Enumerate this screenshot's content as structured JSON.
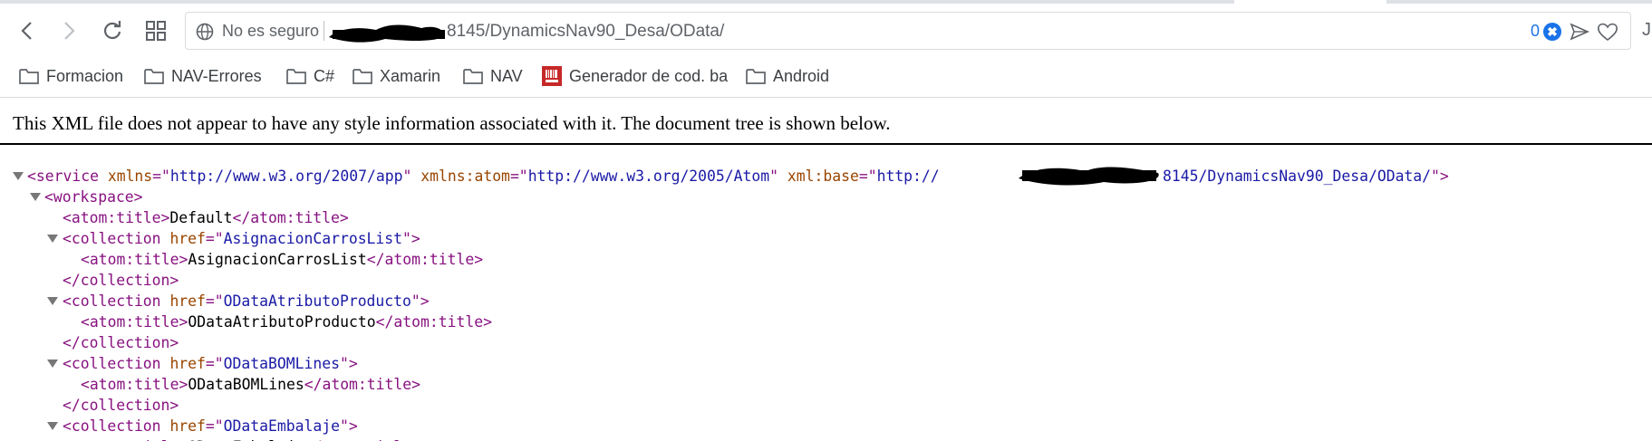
{
  "browser": {
    "omnibox": {
      "security_text": "No es seguro",
      "url_visible": "8145/DynamicsNav90_Desa/OData/",
      "adblock_count": "0",
      "adblock_badge": "✖"
    },
    "profile_initial": "J",
    "icons": [
      "back-arrow-icon",
      "forward-arrow-icon",
      "reload-icon",
      "apps-grid-icon",
      "globe-icon",
      "send-icon",
      "heart-icon",
      "folder-icon"
    ]
  },
  "bookmarks": [
    {
      "label": "Formacion",
      "icon": "folder-icon"
    },
    {
      "label": "NAV-Errores",
      "icon": "folder-icon"
    },
    {
      "label": "C#",
      "icon": "folder-icon"
    },
    {
      "label": "Xamarin",
      "icon": "folder-icon"
    },
    {
      "label": "NAV",
      "icon": "folder-icon"
    },
    {
      "label": "Generador de cod. ba",
      "icon": "barcode-favicon-icon"
    },
    {
      "label": "Android",
      "icon": "folder-icon"
    }
  ],
  "xml_viewer": {
    "notice": "This XML file does not appear to have any style information associated with it. The document tree is shown below.",
    "lines": [
      {
        "parts": [
          [
            "tag",
            "<service"
          ],
          [
            "txt",
            " "
          ],
          [
            "attr",
            "xmlns"
          ],
          [
            "tag",
            "=\""
          ],
          [
            "val",
            "http://www.w3.org/2007/app"
          ],
          [
            "tag",
            "\""
          ],
          [
            "txt",
            " "
          ],
          [
            "attr",
            "xmlns:atom"
          ],
          [
            "tag",
            "=\""
          ],
          [
            "val",
            "http://www.w3.org/2005/Atom"
          ],
          [
            "tag",
            "\""
          ],
          [
            "txt",
            " "
          ],
          [
            "attr",
            "xml:base"
          ],
          [
            "tag",
            "=\""
          ],
          [
            "val",
            "http://"
          ]
        ],
        "tail": [
          [
            "val",
            "8145/DynamicsNav90_Desa/OData/"
          ],
          [
            "tag",
            "\">"
          ]
        ]
      },
      {
        "parts": [
          [
            "tag",
            "<workspace>"
          ]
        ]
      },
      {
        "parts": [
          [
            "tag",
            "<atom:title>"
          ],
          [
            "txt",
            "Default"
          ],
          [
            "tag",
            "</atom:title>"
          ]
        ]
      },
      {
        "parts": [
          [
            "tag",
            "<collection"
          ],
          [
            "txt",
            " "
          ],
          [
            "attr",
            "href"
          ],
          [
            "tag",
            "=\""
          ],
          [
            "val",
            "AsignacionCarrosList"
          ],
          [
            "tag",
            "\">"
          ]
        ]
      },
      {
        "parts": [
          [
            "tag",
            "<atom:title>"
          ],
          [
            "txt",
            "AsignacionCarrosList"
          ],
          [
            "tag",
            "</atom:title>"
          ]
        ]
      },
      {
        "parts": [
          [
            "tag",
            "</collection>"
          ]
        ]
      },
      {
        "parts": [
          [
            "tag",
            "<collection"
          ],
          [
            "txt",
            " "
          ],
          [
            "attr",
            "href"
          ],
          [
            "tag",
            "=\""
          ],
          [
            "val",
            "ODataAtributoProducto"
          ],
          [
            "tag",
            "\">"
          ]
        ]
      },
      {
        "parts": [
          [
            "tag",
            "<atom:title>"
          ],
          [
            "txt",
            "ODataAtributoProducto"
          ],
          [
            "tag",
            "</atom:title>"
          ]
        ]
      },
      {
        "parts": [
          [
            "tag",
            "</collection>"
          ]
        ]
      },
      {
        "parts": [
          [
            "tag",
            "<collection"
          ],
          [
            "txt",
            " "
          ],
          [
            "attr",
            "href"
          ],
          [
            "tag",
            "=\""
          ],
          [
            "val",
            "ODataBOMLines"
          ],
          [
            "tag",
            "\">"
          ]
        ]
      },
      {
        "parts": [
          [
            "tag",
            "<atom:title>"
          ],
          [
            "txt",
            "ODataBOMLines"
          ],
          [
            "tag",
            "</atom:title>"
          ]
        ]
      },
      {
        "parts": [
          [
            "tag",
            "</collection>"
          ]
        ]
      },
      {
        "parts": [
          [
            "tag",
            "<collection"
          ],
          [
            "txt",
            " "
          ],
          [
            "attr",
            "href"
          ],
          [
            "tag",
            "=\""
          ],
          [
            "val",
            "ODataEmbalaje"
          ],
          [
            "tag",
            "\">"
          ]
        ]
      },
      {
        "parts": [
          [
            "tag",
            "<atom:title>"
          ],
          [
            "txt",
            "ODataEmbalaje"
          ],
          [
            "tag",
            "</atom:title>"
          ]
        ]
      }
    ]
  }
}
